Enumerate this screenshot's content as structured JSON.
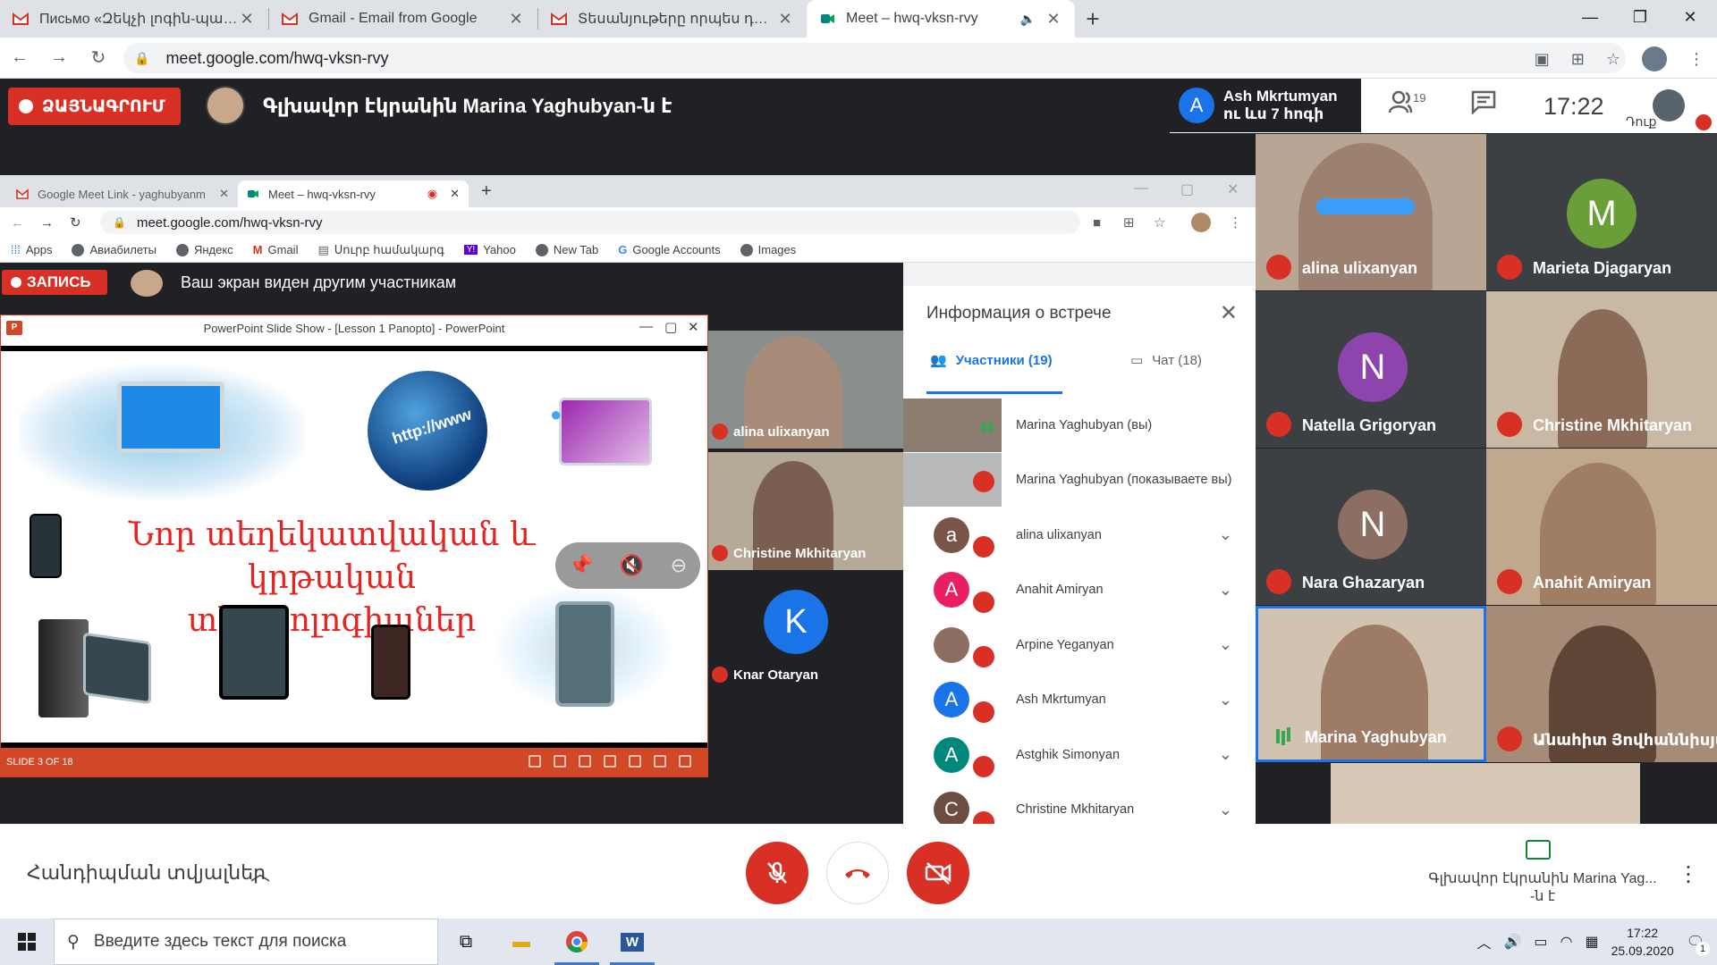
{
  "browser": {
    "tabs": [
      {
        "title": "Письмо «Զեկչի լոգին-պաrոլը",
        "icon": "gmail-icon",
        "active": false
      },
      {
        "title": "Gmail - Email from Google",
        "icon": "gmail-icon",
        "active": false
      },
      {
        "title": "Տեսանյութերը որպես դասանյութ",
        "icon": "gmail-icon",
        "active": false
      },
      {
        "title": "Meet – hwq-vksn-rvy",
        "icon": "meet-icon",
        "active": true
      }
    ],
    "url": "meet.google.com/hwq-vksn-rvy"
  },
  "meet_header": {
    "record_label": "ՁԱՅՆԱԳՐՈՒՄ",
    "presenter_text": "Գլխավոր էկրանին Marina Yaghubyan-ն է",
    "speaker_name": "Ash Mkrtumyan",
    "speaker_more": "ու ևս 7 հոգի",
    "speaker_initial": "A",
    "participants_count": "19",
    "clock": "17:22",
    "me_label": "Դուք"
  },
  "inner_browser": {
    "tabs": [
      {
        "title": "Google Meet Link - yaghubyanm",
        "active": false
      },
      {
        "title": "Meet – hwq-vksn-rvy",
        "active": true
      }
    ],
    "url": "meet.google.com/hwq-vksn-rvy",
    "bookmarks": [
      "Apps",
      "Авиабилеты",
      "Яндекс",
      "Gmail",
      "Սուրբ համակարգ",
      "Yahoo",
      "New Tab",
      "Google Accounts",
      "Images"
    ],
    "record_label": "ЗАПИСЬ",
    "present_text": "Ваш экран виден другим участникам"
  },
  "powerpoint": {
    "window_title": "PowerPoint Slide Show - [Lesson 1 Panopto] - PowerPoint",
    "slide_title_line1": "Նոր տեղեկատվական և",
    "slide_title_line2": "կրթական տեխնոլոգիաներ",
    "globe_text": "http://www",
    "status": "SLIDE 3 OF 18"
  },
  "inner_tiles": [
    {
      "name": "alina ulixanyan"
    },
    {
      "name": "Christine Mkhitaryan"
    },
    {
      "name": "Knar Otaryan",
      "initial": "K"
    }
  ],
  "info_panel": {
    "title": "Информация о встрече",
    "tab_participants": "Участники (19)",
    "tab_chat": "Чат (18)",
    "participants": [
      {
        "name": "Marina Yaghubyan (вы)",
        "type": "video"
      },
      {
        "name": "Marina Yaghubyan (показываете вы)",
        "type": "video"
      },
      {
        "name": "alina ulixanyan",
        "initial": "a",
        "color": "#795548"
      },
      {
        "name": "Anahit Amiryan",
        "initial": "A",
        "color": "#e91e63"
      },
      {
        "name": "Arpine Yeganyan",
        "initial": "",
        "color": "#8d6e63"
      },
      {
        "name": "Ash Mkrtumyan",
        "initial": "A",
        "color": "#1a73e8"
      },
      {
        "name": "Astghik Simonyan",
        "initial": "A",
        "color": "#00897b"
      },
      {
        "name": "Christine Mkhitaryan",
        "initial": "C",
        "color": "#6d4c41"
      }
    ]
  },
  "gallery": [
    {
      "name": "alina ulixanyan",
      "type": "video",
      "muted": true
    },
    {
      "name": "Marieta Djagaryan",
      "type": "avatar",
      "initial": "M",
      "color": "#689f38",
      "muted": true
    },
    {
      "name": "Natella Grigoryan",
      "type": "avatar",
      "initial": "N",
      "color": "#8e44ad",
      "muted": true
    },
    {
      "name": "Christine Mkhitaryan",
      "type": "video",
      "muted": true
    },
    {
      "name": "Nara Ghazaryan",
      "type": "avatar",
      "initial": "N",
      "color": "#8d6e63",
      "muted": true
    },
    {
      "name": "Anahit Amiryan",
      "type": "video",
      "muted": true
    },
    {
      "name": "Marina Yaghubyan",
      "type": "video",
      "muted": false
    },
    {
      "name": "Անահիտ Յովհաննիսյան",
      "type": "video",
      "muted": true
    }
  ],
  "bottom_bar": {
    "details_label": "Հանդիպման տվյալներ",
    "present_label_line1": "Գլխավոր էկրանին Marina Yag...",
    "present_label_line2": "-ն է"
  },
  "taskbar": {
    "search_placeholder": "Введите здесь текст для поиска",
    "time": "17:22",
    "date": "25.09.2020",
    "notifications": "1"
  },
  "colors": {
    "meet_red": "#d93025",
    "meet_blue": "#1a73e8",
    "ppt_orange": "#d24726"
  }
}
